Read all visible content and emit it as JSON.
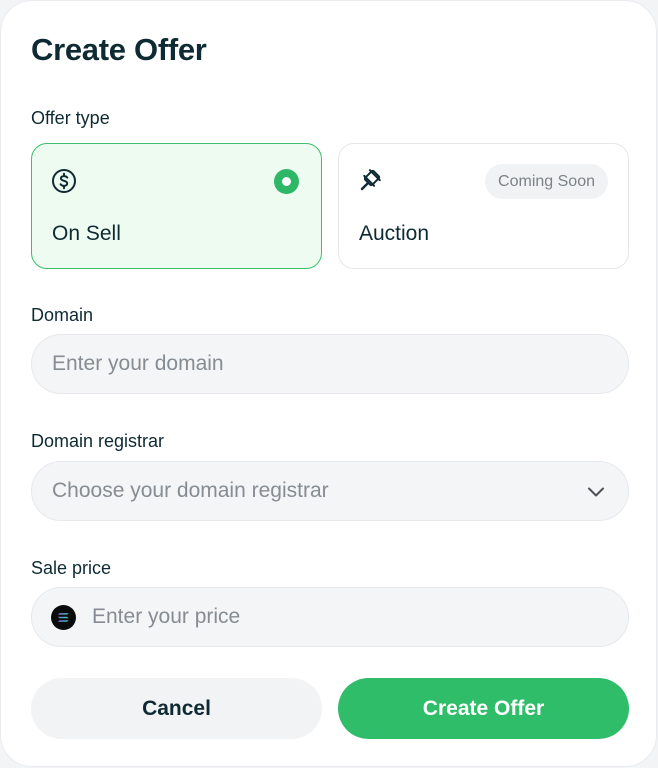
{
  "title": "Create Offer",
  "offer_type": {
    "label": "Offer type",
    "options": [
      {
        "label": "On Sell",
        "icon": "dollar-circle-icon",
        "selected": true
      },
      {
        "label": "Auction",
        "icon": "gavel-icon",
        "badge": "Coming Soon",
        "selected": false
      }
    ]
  },
  "domain": {
    "label": "Domain",
    "placeholder": "Enter your domain",
    "value": ""
  },
  "registrar": {
    "label": "Domain registrar",
    "placeholder": "Choose your domain registrar",
    "icon": "chevron-down-icon"
  },
  "price": {
    "label": "Sale price",
    "placeholder": "Enter your price",
    "value": "",
    "currency_icon": "solana-icon"
  },
  "buttons": {
    "cancel": "Cancel",
    "create": "Create Offer"
  },
  "colors": {
    "accent": "#2fbd69",
    "selected_bg": "#eefbf0",
    "text": "#0e2a33",
    "placeholder": "#858c93"
  }
}
